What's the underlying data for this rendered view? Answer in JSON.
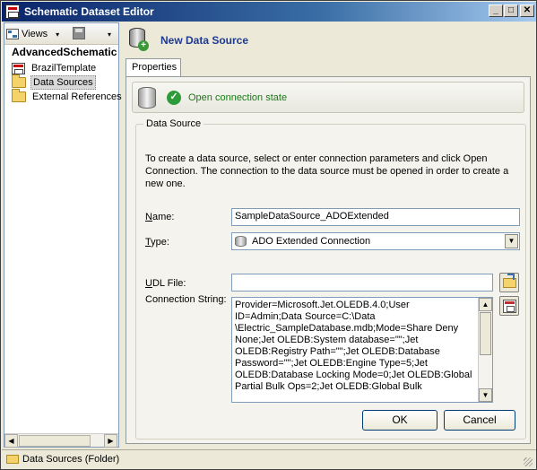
{
  "window": {
    "title": "Schematic Dataset Editor",
    "controls": {
      "minimize": "_",
      "maximize": "□",
      "close": "✕"
    }
  },
  "left_pane": {
    "toolbar": {
      "views_label": "Views",
      "dropdown_glyph": "▾",
      "menu_glyph": "▾"
    },
    "tree": {
      "root": "AdvancedSchematic",
      "items": [
        {
          "label": "BrazilTemplate",
          "icon": "template-icon",
          "selected": false
        },
        {
          "label": "Data Sources",
          "icon": "folder-icon",
          "selected": true
        },
        {
          "label": "External References",
          "icon": "folder-icon",
          "selected": false
        }
      ]
    },
    "scroll": {
      "left": "◀",
      "right": "▶"
    }
  },
  "right_pane": {
    "header_title": "New Data Source",
    "tab_label": "Properties",
    "state_text": "Open connection state",
    "group_title": "Data Source",
    "description": "To create a data source, select or enter connection parameters and click Open Connection.  The connection to the data source must be opened in order to create a new one.",
    "name_label_key": "N",
    "name_label_rest": "ame:",
    "name_value": "SampleDataSource_ADOExtended",
    "type_label_key": "T",
    "type_label_rest": "ype:",
    "type_value": "ADO Extended Connection",
    "udl_label_key": "U",
    "udl_label_rest": "DL File:",
    "udl_value": "",
    "conn_label": "Connection String:",
    "conn_value": "Provider=Microsoft.Jet.OLEDB.4.0;User ID=Admin;Data Source=C:\\Data \\Electric_SampleDatabase.mdb;Mode=Share Deny None;Jet OLEDB:System database=\"\";Jet OLEDB:Registry Path=\"\";Jet OLEDB:Database Password=\"\";Jet OLEDB:Engine Type=5;Jet OLEDB:Database Locking Mode=0;Jet OLEDB:Global Partial Bulk Ops=2;Jet OLEDB:Global Bulk",
    "scroll_up": "▲",
    "scroll_down": "▼",
    "ok_label": "OK",
    "cancel_label": "Cancel"
  },
  "status_bar": {
    "text": "Data Sources (Folder)"
  }
}
